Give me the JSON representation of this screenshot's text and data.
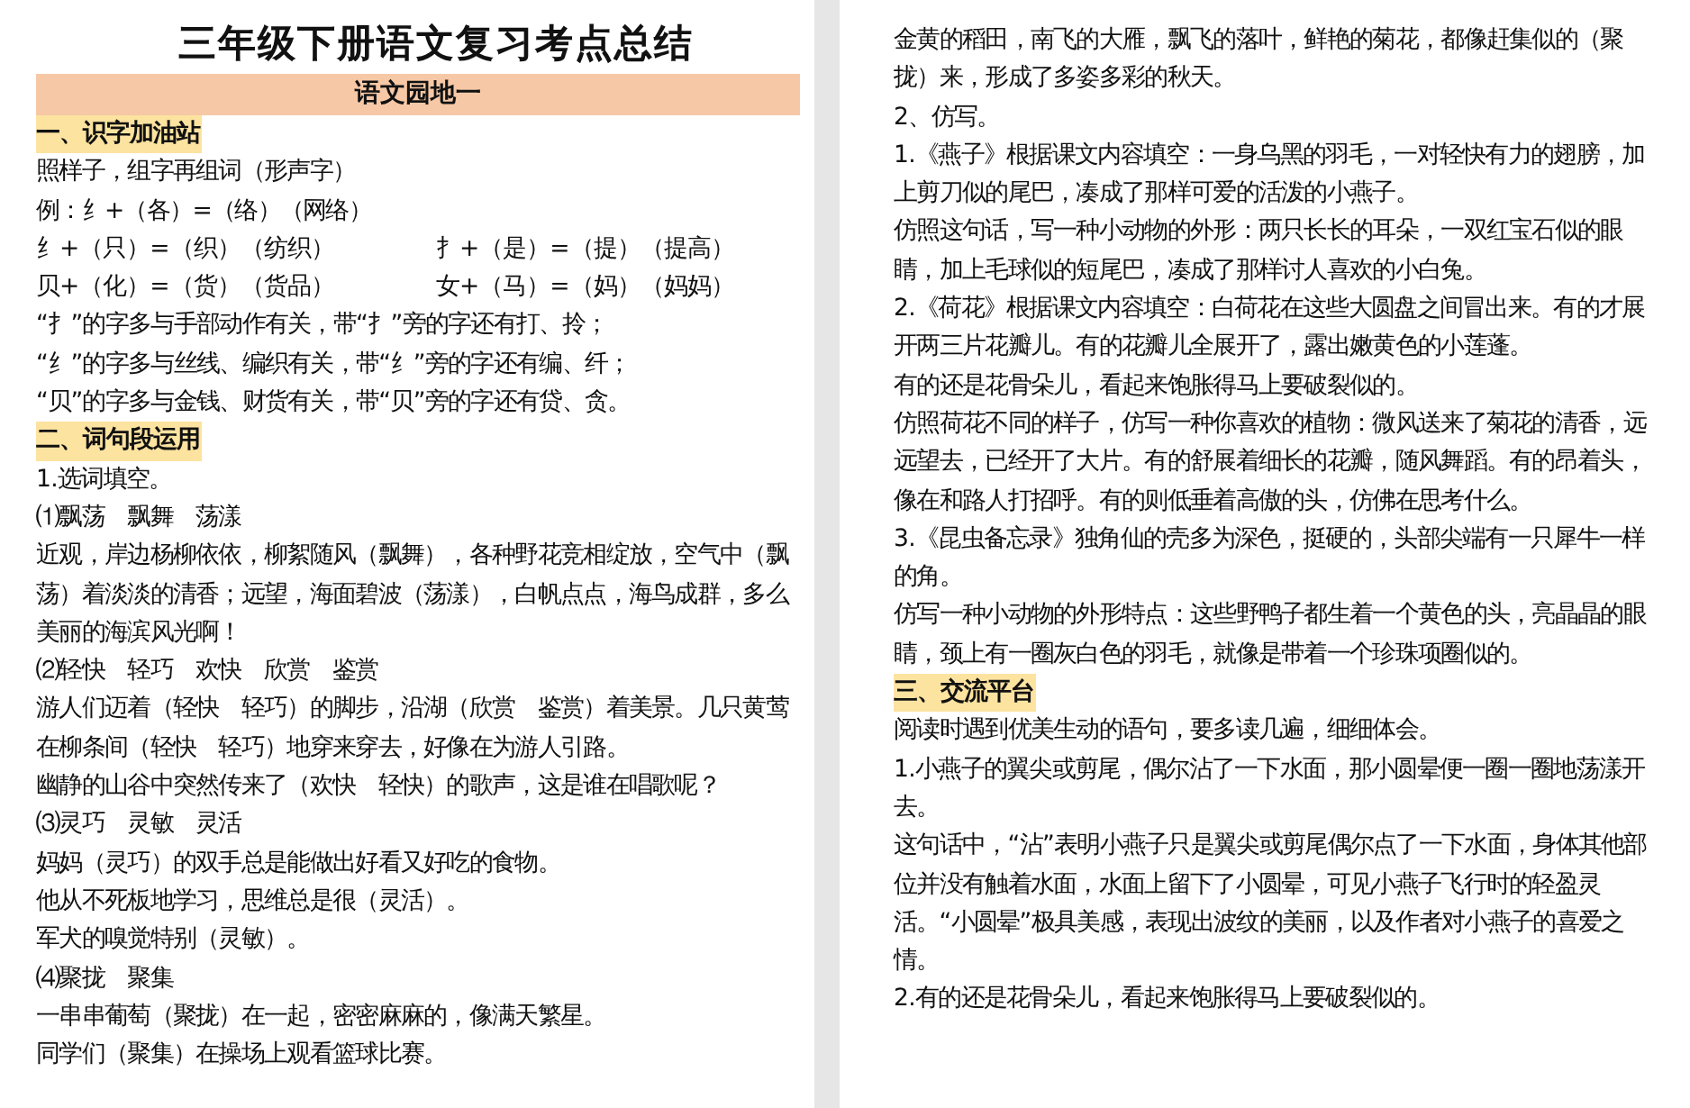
{
  "pages": [
    {
      "title": "三年级下册语文复习考点总结",
      "blocks": [
        {
          "kind": "banner",
          "text": "语文园地一"
        },
        {
          "kind": "heading",
          "text": "一、识字加油站"
        },
        {
          "kind": "para",
          "text": "照样子，组字再组词（形声字）"
        },
        {
          "kind": "para",
          "text": "例：纟+（各）=（络）（网络）"
        },
        {
          "kind": "pair",
          "items": [
            "纟+（只）=（织）（纺织）",
            "扌+（是）=（提）（提高）"
          ]
        },
        {
          "kind": "pair",
          "items": [
            "贝+（化）=（货）（货品）",
            "女+（马）=（妈）（妈妈）"
          ]
        },
        {
          "kind": "para",
          "text": "“扌”的字多与手部动作有关，带“扌”旁的字还有打、拎；"
        },
        {
          "kind": "para",
          "text": "“纟”的字多与丝线、编织有关，带“纟”旁的字还有编、纤；"
        },
        {
          "kind": "para",
          "text": "“贝”的字多与金钱、财货有关，带“贝”旁的字还有贷、贪。"
        },
        {
          "kind": "heading",
          "text": "二、词句段运用"
        },
        {
          "kind": "para",
          "text": "1.选词填空。"
        },
        {
          "kind": "para",
          "text": "⑴飘荡　飘舞　荡漾"
        },
        {
          "kind": "para",
          "text": "近观，岸边杨柳依依，柳絮随风（飘舞），各种野花竞相绽放，空气中（飘荡）着淡淡的清香；远望，海面碧波（荡漾），白帆点点，海鸟成群，多么美丽的海滨风光啊！"
        },
        {
          "kind": "para",
          "text": "⑵轻快　轻巧　欢快　欣赏　鉴赏"
        },
        {
          "kind": "para",
          "text": "游人们迈着（轻快　轻巧）的脚步，沿湖（欣赏　鉴赏）着美景。几只黄莺在柳条间（轻快　轻巧）地穿来穿去，好像在为游人引路。"
        },
        {
          "kind": "para",
          "text": "幽静的山谷中突然传来了（欢快　轻快）的歌声，这是谁在唱歌呢？"
        },
        {
          "kind": "para",
          "text": "⑶灵巧　灵敏　灵活"
        },
        {
          "kind": "para",
          "text": "妈妈（灵巧）的双手总是能做出好看又好吃的食物。"
        },
        {
          "kind": "para",
          "text": "他从不死板地学习，思维总是很（灵活）。"
        },
        {
          "kind": "para",
          "text": "军犬的嗅觉特别（灵敏）。"
        },
        {
          "kind": "para",
          "text": "⑷聚拢　聚集"
        },
        {
          "kind": "para",
          "text": "一串串葡萄（聚拢）在一起，密密麻麻的，像满天繁星。"
        },
        {
          "kind": "para",
          "text": "同学们（聚集）在操场上观看篮球比赛。"
        }
      ]
    },
    {
      "blocks": [
        {
          "kind": "para",
          "text": "金黄的稻田，南飞的大雁，飘飞的落叶，鲜艳的菊花，都像赶集似的（聚拢）来，形成了多姿多彩的秋天。"
        },
        {
          "kind": "para",
          "text": "2、仿写。"
        },
        {
          "kind": "para",
          "text": "1.《燕子》根据课文内容填空：一身乌黑的羽毛，一对轻快有力的翅膀，加上剪刀似的尾巴，凑成了那样可爱的活泼的小燕子。"
        },
        {
          "kind": "para",
          "text": "仿照这句话，写一种小动物的外形：两只长长的耳朵，一双红宝石似的眼睛，加上毛球似的短尾巴，凑成了那样讨人喜欢的小白兔。"
        },
        {
          "kind": "para",
          "text": "2.《荷花》根据课文内容填空：白荷花在这些大圆盘之间冒出来。有的才展开两三片花瓣儿。有的花瓣儿全展开了，露出嫩黄色的小莲蓬。"
        },
        {
          "kind": "para",
          "text": "有的还是花骨朵儿，看起来饱胀得马上要破裂似的。"
        },
        {
          "kind": "para",
          "text": "仿照荷花不同的样子，仿写一种你喜欢的植物：微风送来了菊花的清香，远远望去，已经开了大片。有的舒展着细长的花瓣，随风舞蹈。有的昂着头，像在和路人打招呼。有的则低垂着高傲的头，仿佛在思考什么。"
        },
        {
          "kind": "para",
          "text": "3.《昆虫备忘录》独角仙的壳多为深色，挺硬的，头部尖端有一只犀牛一样的角。"
        },
        {
          "kind": "para",
          "text": "仿写一种小动物的外形特点：这些野鸭子都生着一个黄色的头，亮晶晶的眼睛，颈上有一圈灰白色的羽毛，就像是带着一个珍珠项圈似的。"
        },
        {
          "kind": "heading",
          "text": "三、交流平台"
        },
        {
          "kind": "para",
          "text": "阅读时遇到优美生动的语句，要多读几遍，细细体会。"
        },
        {
          "kind": "para",
          "text": "1.小燕子的翼尖或剪尾，偶尔沾了一下水面，那小圆晕便一圈一圈地荡漾开去。"
        },
        {
          "kind": "para",
          "text": "这句话中，“沾”表明小燕子只是翼尖或剪尾偶尔点了一下水面，身体其他部位并没有触着水面，水面上留下了小圆晕，可见小燕子飞行时的轻盈灵活。“小圆晕”极具美感，表现出波纹的美丽，以及作者对小燕子的喜爱之情。"
        },
        {
          "kind": "para",
          "text": "2.有的还是花骨朵儿，看起来饱胀得马上要破裂似的。"
        }
      ]
    }
  ]
}
